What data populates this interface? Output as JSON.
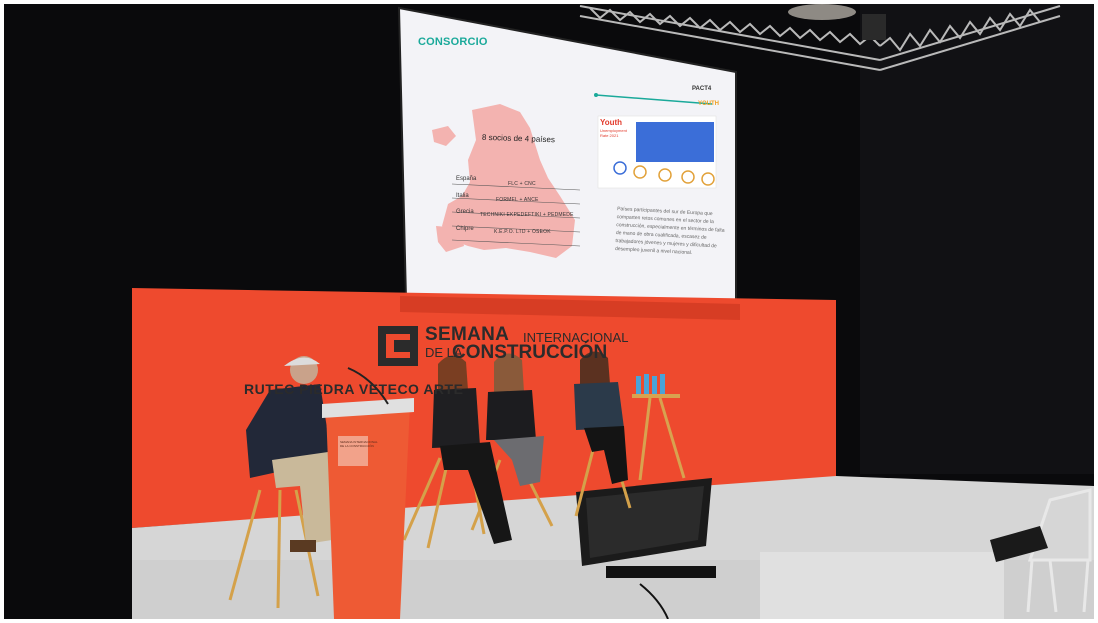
{
  "slide": {
    "title": "CONSORCIO",
    "subtitle": "8 socios de 4 países",
    "rows": [
      {
        "country": "España",
        "partners": "FLC + CNC"
      },
      {
        "country": "Italia",
        "partners": "FORMEL + ANCE"
      },
      {
        "country": "Grecia",
        "partners": "TECHNIKI EKPEDEFTIKI + PEDMEDE"
      },
      {
        "country": "Chipre",
        "partners": "K.E.P.O. LTD + OSEOK"
      }
    ],
    "logo_pactx": "PACT4",
    "logo_youth": "YOUTH",
    "youth_title": "Youth",
    "youth_sub": "Unemployment Rate 2021",
    "paragraph": "Países participantes del sur de Europa que comparten retos comunes en el sector de la construcción, especialmente en términos de falta de mano de obra cualificada, escasez de trabajadores jóvenes y mujeres y dificultad de desempleo juvenil a nivel nacional."
  },
  "banner": {
    "semana": "SEMANA",
    "internacional": "INTERNACIONAL",
    "de_la": "DE LA",
    "construccion": "CONSTRUCCIÓN",
    "brands": "RUTEC  PIEDRA  VETECO  ARTE"
  },
  "podium": {
    "lines": [
      "SEMANA INTERNACIONAL",
      "DE LA CONSTRUCCIÓN"
    ]
  },
  "colors": {
    "stage_backdrop": "#ee4a2e",
    "stage_floor": "#d9d9d9",
    "screen_bg": "#f4f4f8",
    "accent_teal": "#1aa99a"
  }
}
